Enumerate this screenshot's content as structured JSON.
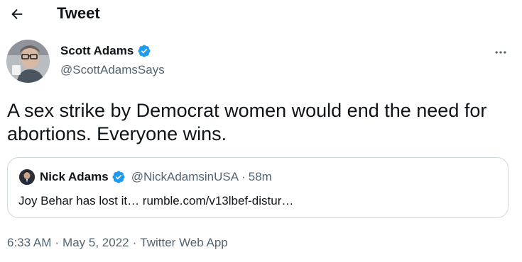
{
  "header": {
    "back_icon": "arrow-left-icon",
    "title": "Tweet"
  },
  "tweet": {
    "author": {
      "name": "Scott Adams",
      "handle": "@ScottAdamsSays",
      "verified": true
    },
    "more_icon": "more-horizontal-icon",
    "text": "A sex strike by Democrat women would end the need for abortions. Everyone wins.",
    "quoted": {
      "name": "Nick Adams",
      "handle": "@NickAdamsinUSA",
      "separator": "·",
      "time": "58m",
      "verified": true,
      "text": "Joy Behar has lost it… rumble.com/v13lbef-distur…"
    },
    "meta": {
      "time": "6:33 AM",
      "sep1": "·",
      "date": "May 5, 2022",
      "sep2": "·",
      "source": "Twitter Web App"
    }
  },
  "colors": {
    "verified_blue": "#1d9bf0",
    "secondary_text": "#536471",
    "border": "#cfd9de",
    "primary_text": "#0f1419"
  }
}
